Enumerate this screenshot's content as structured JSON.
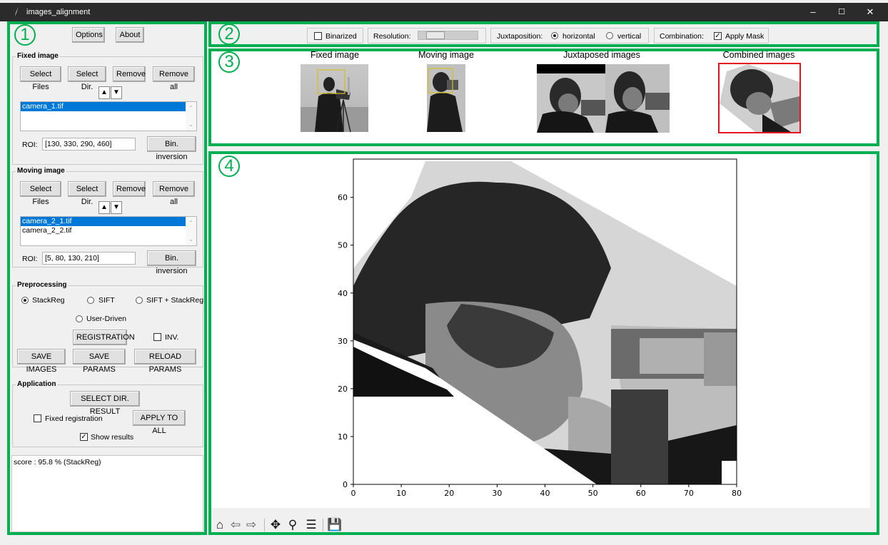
{
  "window": {
    "title": "images_alignment",
    "minimize": "–",
    "maximize": "☐",
    "close": "✕"
  },
  "markers": [
    "1",
    "2",
    "3",
    "4"
  ],
  "left": {
    "options_label": "Options",
    "about_label": "About",
    "fixed": {
      "title": "Fixed image",
      "select_files": "Select Files",
      "select_dir": "Select Dir.",
      "remove": "Remove",
      "remove_all": "Remove all",
      "files": [
        "camera_1.tif"
      ],
      "roi_label": "ROI:",
      "roi_value": "[130, 330, 290, 460]",
      "bin_inversion": "Bin. inversion"
    },
    "moving": {
      "title": "Moving image",
      "select_files": "Select Files",
      "select_dir": "Select Dir.",
      "remove": "Remove",
      "remove_all": "Remove all",
      "files": [
        "camera_2_1.tif",
        "camera_2_2.tif"
      ],
      "roi_label": "ROI:",
      "roi_value": "[5, 80, 130, 210]",
      "bin_inversion": "Bin. inversion"
    },
    "preprocessing": {
      "title": "Preprocessing",
      "stackreg": "StackReg",
      "sift": "SIFT",
      "sift_stackreg": "SIFT + StackReg",
      "user_driven": "User-Driven",
      "registration": "REGISTRATION",
      "inv": "INV.",
      "save_images": "SAVE IMAGES",
      "save_params": "SAVE PARAMS",
      "reload_params": "RELOAD PARAMS"
    },
    "application": {
      "title": "Application",
      "select_dir_result": "SELECT DIR. RESULT",
      "fixed_registration": "Fixed registration",
      "apply_to_all": "APPLY TO ALL",
      "show_results": "Show results"
    },
    "log": "score : 95.8 % (StackReg)"
  },
  "toolbar": {
    "binarized": "Binarized",
    "resolution_label": "Resolution:",
    "resolution_value": 0.2,
    "juxtaposition_label": "Juxtaposition:",
    "horizontal": "horizontal",
    "vertical": "vertical",
    "combination_label": "Combination:",
    "apply_mask": "Apply Mask"
  },
  "previews": {
    "fixed": "Fixed image",
    "moving": "Moving image",
    "juxtaposed": "Juxtaposed images",
    "combined": "Combined images"
  },
  "chart_data": {
    "type": "heatmap",
    "xlim": [
      0,
      80
    ],
    "ylim": [
      0,
      68
    ],
    "xticks": [
      0,
      10,
      20,
      30,
      40,
      50,
      60,
      70,
      80
    ],
    "yticks": [
      0,
      10,
      20,
      30,
      40,
      50,
      60
    ]
  },
  "icons": [
    "home-icon",
    "back-icon",
    "forward-icon",
    "pan-icon",
    "zoom-icon",
    "configure-icon",
    "save-icon"
  ]
}
